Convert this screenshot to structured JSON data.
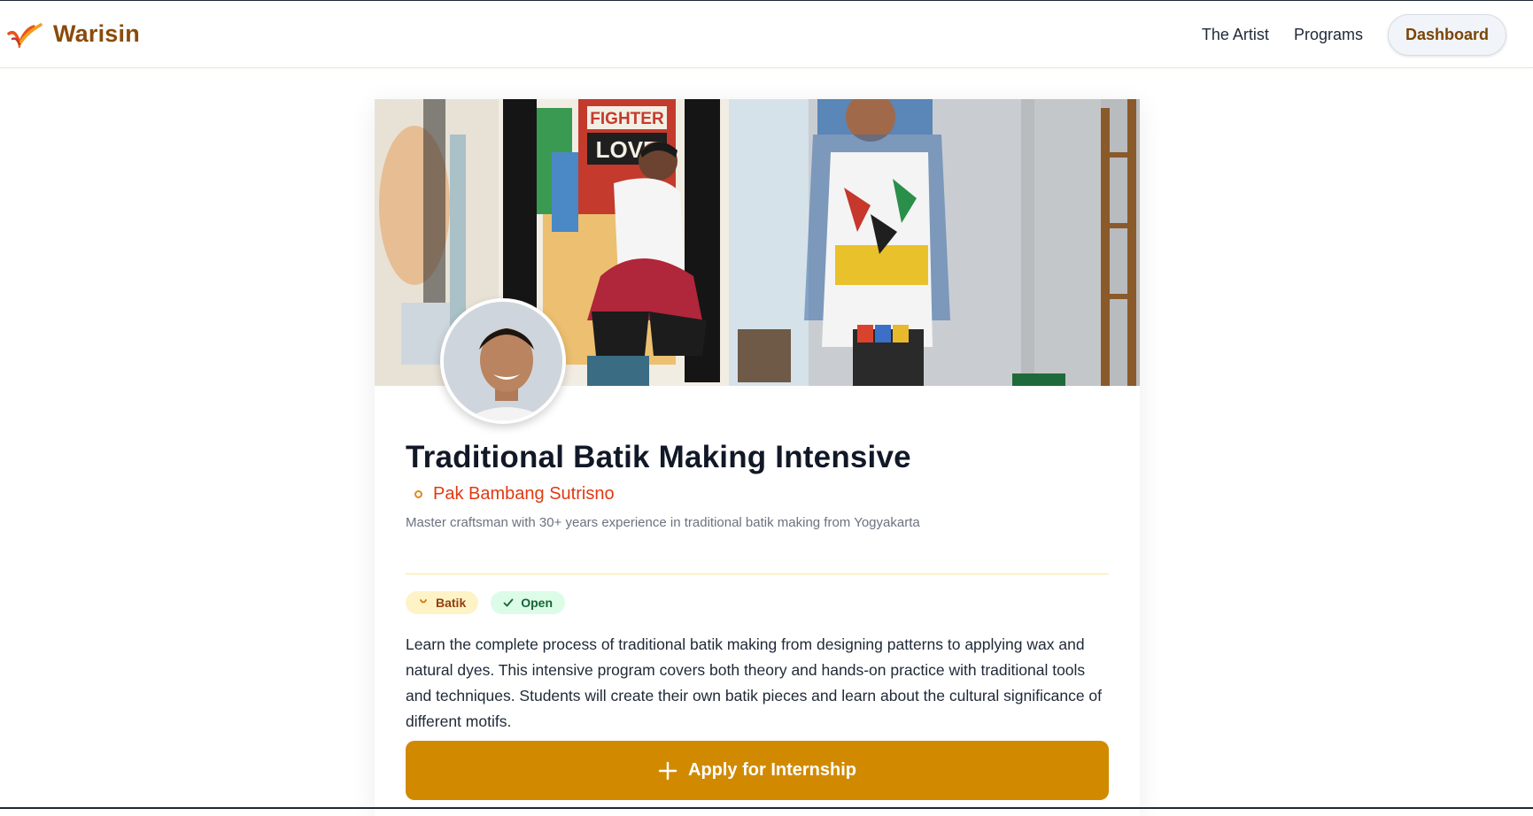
{
  "brand": {
    "name": "Warisin",
    "logo_icon": "warisin-logo-icon"
  },
  "nav": {
    "links": [
      "The Artist",
      "Programs"
    ],
    "dashboard_label": "Dashboard"
  },
  "program": {
    "title": "Traditional Batik Making Intensive",
    "artist_name": "Pak Bambang Sutrisno",
    "artist_bio": "Master craftsman with 30+ years experience in traditional batik making from Yogyakarta",
    "badges": {
      "category": "Batik",
      "status": "Open"
    },
    "description": "Learn the complete process of traditional batik making from designing patterns to applying wax and natural dyes. This intensive program covers both theory and hands-on practice with traditional tools and techniques. Students will create their own batik pieces and learn about the cultural significance of different motifs.",
    "apply_label": "Apply for Internship"
  },
  "hero_image": {
    "sign_line1": "FIGHTER",
    "sign_line2": "LOVE"
  },
  "colors": {
    "brand": "#8a4b0a",
    "accent": "#d18a00",
    "artist": "#e03a12",
    "badge_batik_bg": "#fef3c7",
    "badge_open_bg": "#dcfce7"
  }
}
